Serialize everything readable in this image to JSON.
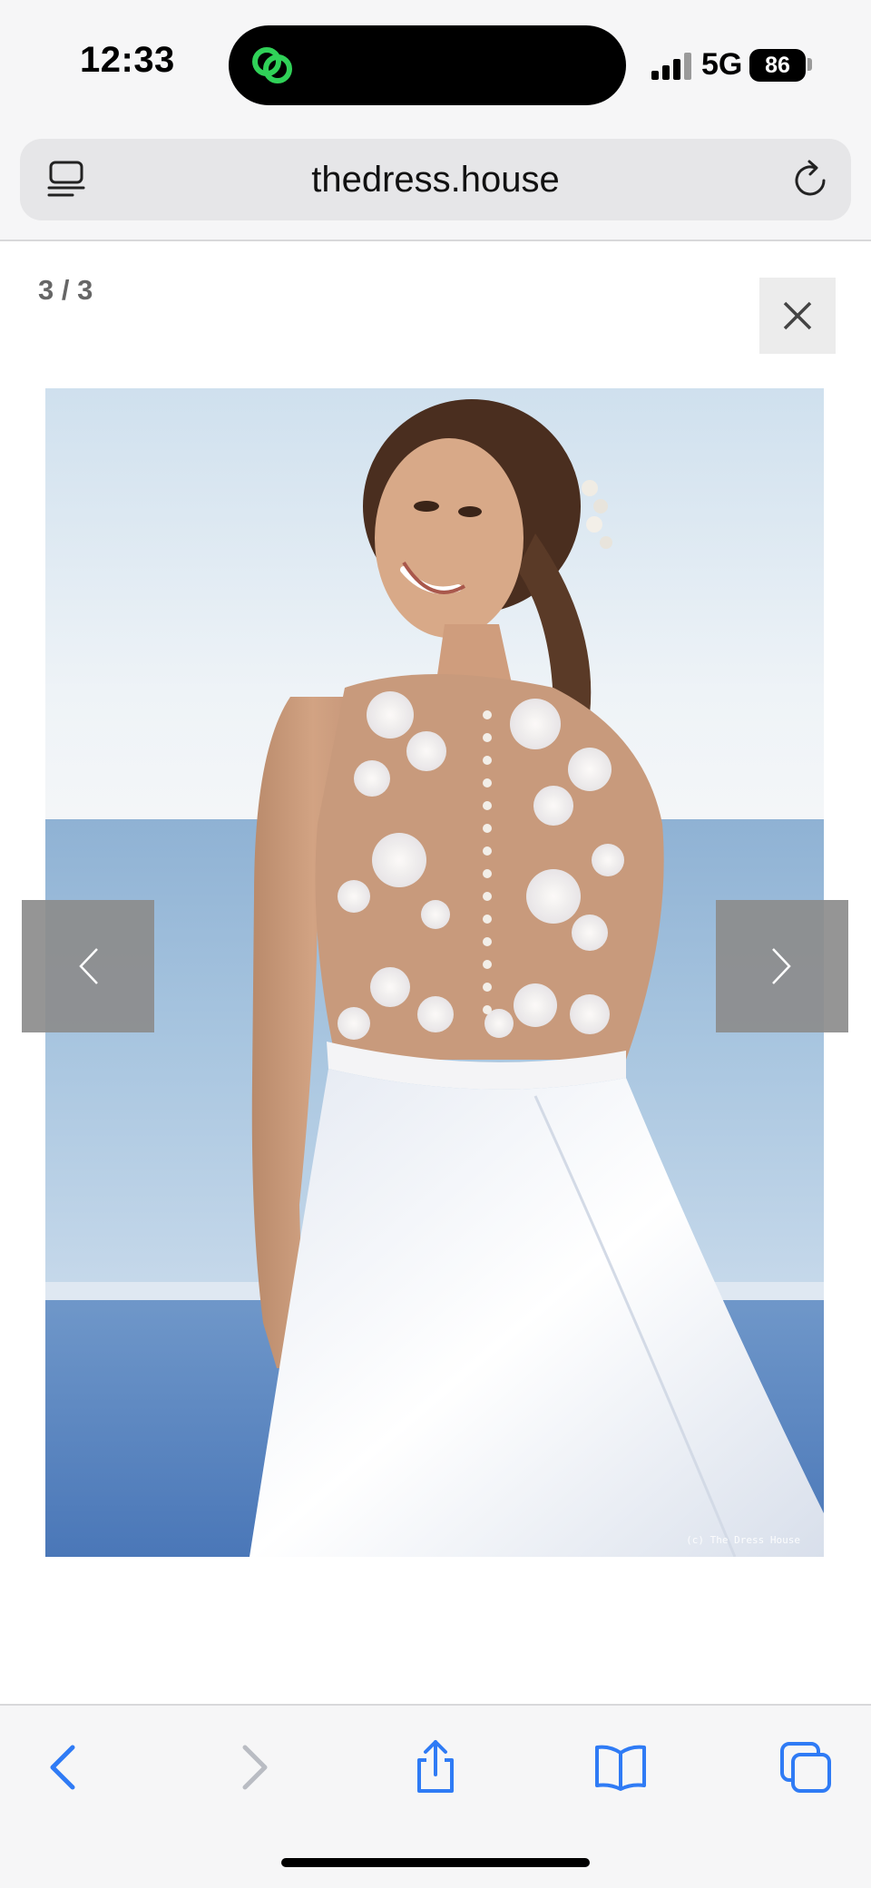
{
  "status_bar": {
    "time": "12:33",
    "network": "5G",
    "battery": "86"
  },
  "browser": {
    "url": "thedress.house",
    "reader_icon": "reader-view-icon",
    "reload_icon": "reload-icon"
  },
  "lightbox": {
    "counter": "3 / 3",
    "close_icon": "close-icon",
    "prev_icon": "chevron-left-icon",
    "next_icon": "chevron-right-icon",
    "watermark": "(c) The Dress House"
  },
  "toolbar": {
    "items": [
      {
        "icon": "back-icon",
        "enabled": true
      },
      {
        "icon": "forward-icon",
        "enabled": false
      },
      {
        "icon": "share-icon",
        "enabled": true
      },
      {
        "icon": "bookmarks-icon",
        "enabled": true
      },
      {
        "icon": "tabs-icon",
        "enabled": true
      }
    ]
  },
  "colors": {
    "accent": "#2f7bf5",
    "disabled": "#b9bcc3",
    "island_app": "#30d158"
  }
}
